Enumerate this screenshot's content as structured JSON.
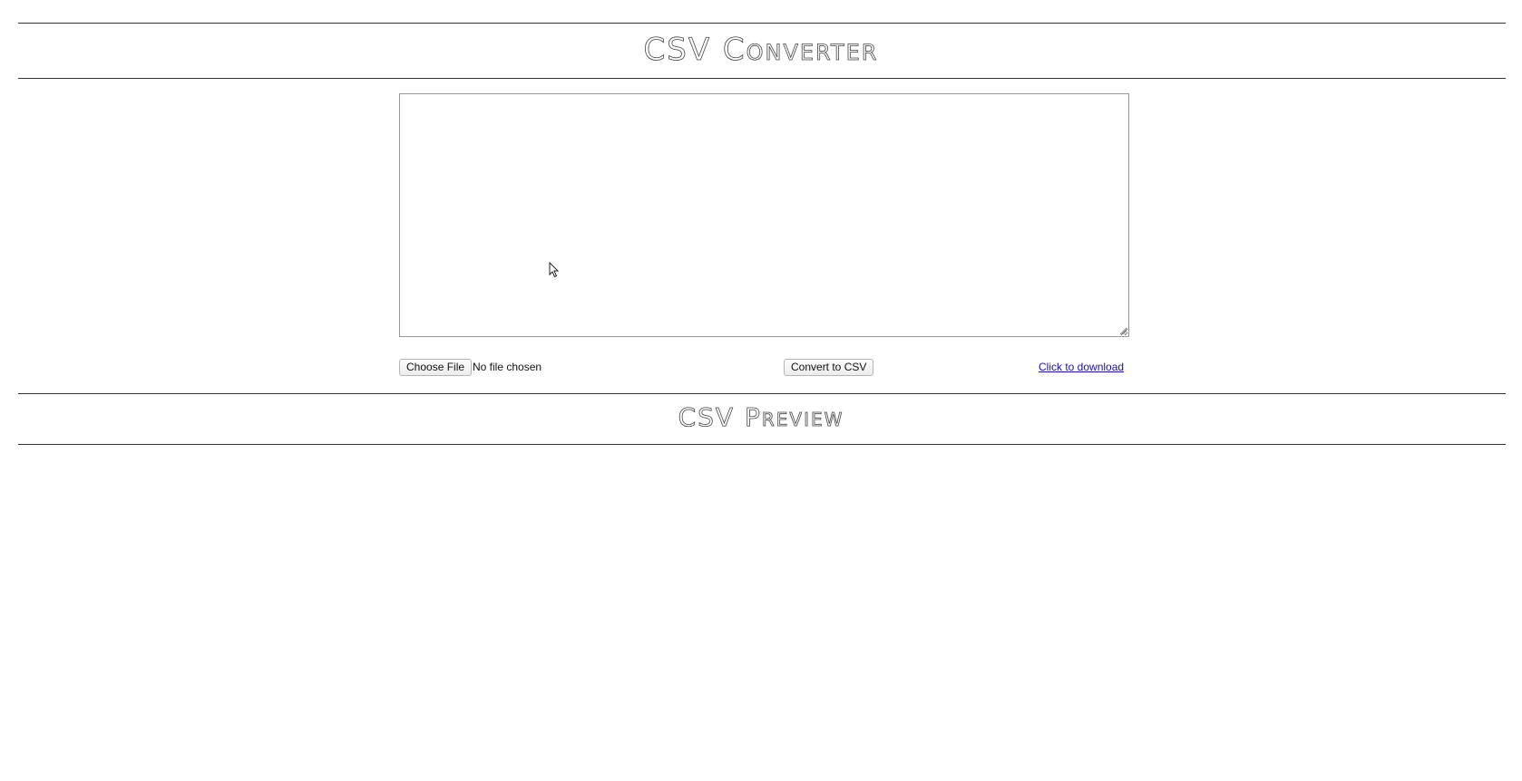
{
  "header": {
    "title": "CSV Converter"
  },
  "editor": {
    "value": "",
    "placeholder": ""
  },
  "controls": {
    "choose_file_label": "Choose File",
    "file_status": "No file chosen",
    "convert_label": "Convert to CSV",
    "download_label": "Click to download"
  },
  "preview": {
    "title": "CSV Preview"
  },
  "icons": {
    "cursor": "mouse-pointer-icon",
    "resize": "resize-grip-icon"
  }
}
